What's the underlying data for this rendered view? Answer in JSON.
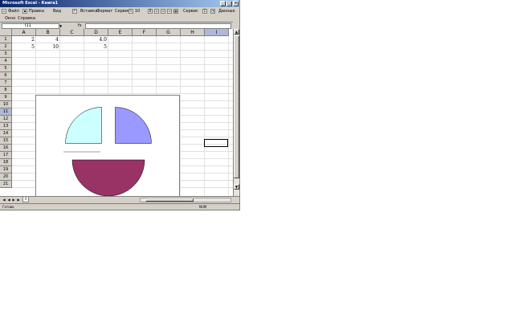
{
  "window": {
    "title": "Microsoft Excel - Книга1",
    "controls": [
      "_",
      "□",
      "×"
    ]
  },
  "menu": {
    "items": [
      "Файл",
      "Правка",
      "Вид",
      "Вставка",
      "Формат",
      "Сервис",
      "Данные"
    ],
    "font_size": "10",
    "second_row": [
      "Окно",
      "Справка"
    ]
  },
  "formula_bar": {
    "name_box": "I11",
    "fx": "fx",
    "value": ""
  },
  "columns": [
    "A",
    "B",
    "C",
    "D",
    "E",
    "F",
    "G",
    "H",
    "I"
  ],
  "selected_column": "I",
  "rows": [
    "1",
    "2",
    "3",
    "4",
    "5",
    "6",
    "7",
    "8",
    "9",
    "10",
    "11",
    "12",
    "13",
    "14",
    "15",
    "16",
    "17",
    "18",
    "19",
    "20",
    "21"
  ],
  "selected_row": "11",
  "cells": [
    {
      "ref": "A1",
      "value": "2"
    },
    {
      "ref": "B1",
      "value": "4"
    },
    {
      "ref": "D1",
      "value": "4.0"
    },
    {
      "ref": "A2",
      "value": "5"
    },
    {
      "ref": "B2",
      "value": "10"
    },
    {
      "ref": "D2",
      "value": "5"
    }
  ],
  "chart_data": {
    "type": "pie",
    "slices": [
      {
        "label": "",
        "value": 25,
        "color": "#ccffff"
      },
      {
        "label": "",
        "value": 25,
        "color": "#9999ff"
      },
      {
        "label": "",
        "value": 50,
        "color": "#993366"
      }
    ]
  },
  "sheet_tabs": [
    "Л"
  ],
  "status": {
    "text": "Готово",
    "num": "NUM"
  }
}
